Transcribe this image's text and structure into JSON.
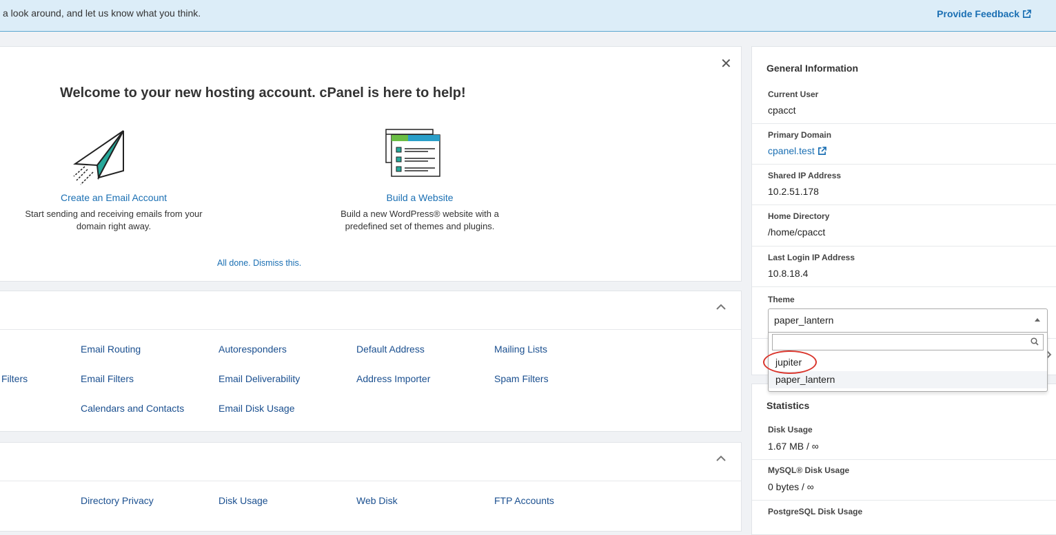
{
  "banner": {
    "text": "a look around, and let us know what you think.",
    "feedback_label": "Provide Feedback"
  },
  "welcome": {
    "title": "Welcome to your new hosting account. cPanel is here to help!",
    "cards": [
      {
        "link": "Create an Email Account",
        "desc_line1": "Start sending and receiving emails from your",
        "desc_line2": "domain right away."
      },
      {
        "link": "Build a Website",
        "desc_line1": "Build a new WordPress® website with a",
        "desc_line2": "predefined set of themes and plugins."
      }
    ],
    "dismiss_label": "All done. Dismiss this."
  },
  "email_section": {
    "items": [
      "Email Routing",
      "Autoresponders",
      "Default Address",
      "Mailing Lists",
      "Filters",
      "Email Filters",
      "Email Deliverability",
      "Address Importer",
      "Spam Filters",
      "Calendars and Contacts",
      "Email Disk Usage"
    ]
  },
  "files_section": {
    "items": [
      "Directory Privacy",
      "Disk Usage",
      "Web Disk",
      "FTP Accounts"
    ]
  },
  "general_info": {
    "title": "General Information",
    "current_user_label": "Current User",
    "current_user": "cpacct",
    "primary_domain_label": "Primary Domain",
    "primary_domain": "cpanel.test",
    "shared_ip_label": "Shared IP Address",
    "shared_ip": "10.2.51.178",
    "home_dir_label": "Home Directory",
    "home_dir": "/home/cpacct",
    "last_login_label": "Last Login IP Address",
    "last_login": "10.8.18.4",
    "theme_label": "Theme",
    "theme_selected": "paper_lantern",
    "theme_search_value": "",
    "theme_options": [
      "jupiter",
      "paper_lantern"
    ]
  },
  "statistics": {
    "title": "Statistics",
    "disk_usage_label": "Disk Usage",
    "disk_usage": "1.67 MB / ∞",
    "mysql_label": "MySQL® Disk Usage",
    "mysql": "0 bytes / ∞",
    "postgres_label": "PostgreSQL Disk Usage"
  },
  "colors": {
    "link": "#1a6fb3",
    "nav_link": "#1a4f8f",
    "banner_bg": "#dcedf8",
    "highlight_ring": "#d9352c"
  }
}
